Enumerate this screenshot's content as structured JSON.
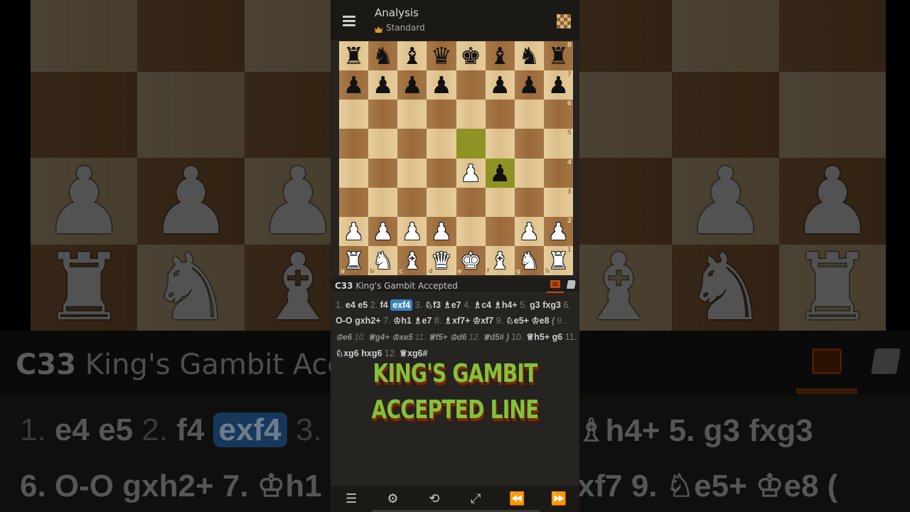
{
  "header": {
    "title": "Analysis",
    "variant": "Standard",
    "menu_icon": "hamburger-menu-icon",
    "board_icon": "board-settings-icon",
    "variant_icon": "crown-icon"
  },
  "board": {
    "orientation": "white",
    "files": [
      "a",
      "b",
      "c",
      "d",
      "e",
      "f",
      "g",
      "h"
    ],
    "ranks": [
      "8",
      "7",
      "6",
      "5",
      "4",
      "3",
      "2",
      "1"
    ],
    "position": [
      [
        "r",
        "n",
        "b",
        "q",
        "k",
        "b",
        "n",
        "r"
      ],
      [
        "p",
        "p",
        "p",
        "p",
        "",
        "p",
        "p",
        "p"
      ],
      [
        "",
        "",
        "",
        "",
        "",
        "",
        "",
        ""
      ],
      [
        "",
        "",
        "",
        "",
        "",
        "",
        "",
        ""
      ],
      [
        "",
        "",
        "",
        "",
        "P",
        "p",
        "",
        ""
      ],
      [
        "",
        "",
        "",
        "",
        "",
        "",
        "",
        ""
      ],
      [
        "P",
        "P",
        "P",
        "P",
        "",
        "",
        "P",
        "P"
      ],
      [
        "R",
        "N",
        "B",
        "Q",
        "K",
        "B",
        "N",
        "R"
      ]
    ],
    "last_move": [
      "e5",
      "f4"
    ],
    "highlight_color": "#8f9323"
  },
  "opening": {
    "eco": "C33",
    "name": "King's Gambit Accepted"
  },
  "tabs": [
    {
      "name": "moves-tab-icon",
      "active": true,
      "color": "#c64a12"
    },
    {
      "name": "opening-book-tab-icon",
      "active": false
    }
  ],
  "moves": {
    "mainline_1": [
      {
        "n": "1.",
        "w": "e4",
        "b": "e5"
      },
      {
        "n": "2.",
        "w": "f4",
        "b": "exf4",
        "current": "b"
      },
      {
        "n": "3.",
        "w": "♘f3",
        "b": "♗e7"
      },
      {
        "n": "4.",
        "w": "♗c4",
        "b": "♗h4+"
      },
      {
        "n": "5.",
        "w": "g3",
        "b": "fxg3"
      },
      {
        "n": "6.",
        "w": "O-O",
        "b": "gxh2+"
      },
      {
        "n": "7.",
        "w": "♔h1",
        "b": "♗e7"
      },
      {
        "n": "8.",
        "w": "♗xf7+",
        "b": "♔xf7"
      },
      {
        "n": "9.",
        "w": "♘e5+",
        "b": "♔e8"
      }
    ],
    "variation": [
      {
        "n": "9...",
        "b": "♔e6"
      },
      {
        "n": "10.",
        "w": "♕g4+",
        "b": "♔xe5"
      },
      {
        "n": "11.",
        "w": "♕f5+",
        "b": "♔d6"
      },
      {
        "n": "12.",
        "w": "♕d5#"
      }
    ],
    "mainline_2": [
      {
        "n": "10.",
        "w": "♕h5+",
        "b": "g6"
      },
      {
        "n": "11.",
        "w": "♘xg6",
        "b": "hxg6"
      },
      {
        "n": "12.",
        "w": "♕xg6#"
      }
    ],
    "highlight_color": "#3b83c0"
  },
  "overlay": {
    "line1": "KING'S GAMBIT",
    "line2": "ACCEPTED LINE",
    "color": "#82c33a"
  },
  "toolbar": [
    {
      "name": "move-list-icon",
      "glyph": "☰"
    },
    {
      "name": "settings-gear-icon",
      "glyph": "⚙"
    },
    {
      "name": "flip-board-icon",
      "glyph": "⟲"
    },
    {
      "name": "expand-icon",
      "glyph": "⤢"
    },
    {
      "name": "previous-move-icon",
      "glyph": "⏪"
    },
    {
      "name": "next-move-icon",
      "glyph": "⏩"
    }
  ],
  "background_echo": {
    "opening_text_eco": "C33",
    "opening_text_name": "King's Gambit Acc",
    "moves_row1": "1. e4 e5 2. f4 exf4 3.",
    "moves_row1_right": "♗h4+ 5. g3 fxg3",
    "moves_row2": "6. O-O gxh2+ 7. ♔h1",
    "moves_row2_right": "xf7 9. ♘e5+ ♔e8 ("
  }
}
